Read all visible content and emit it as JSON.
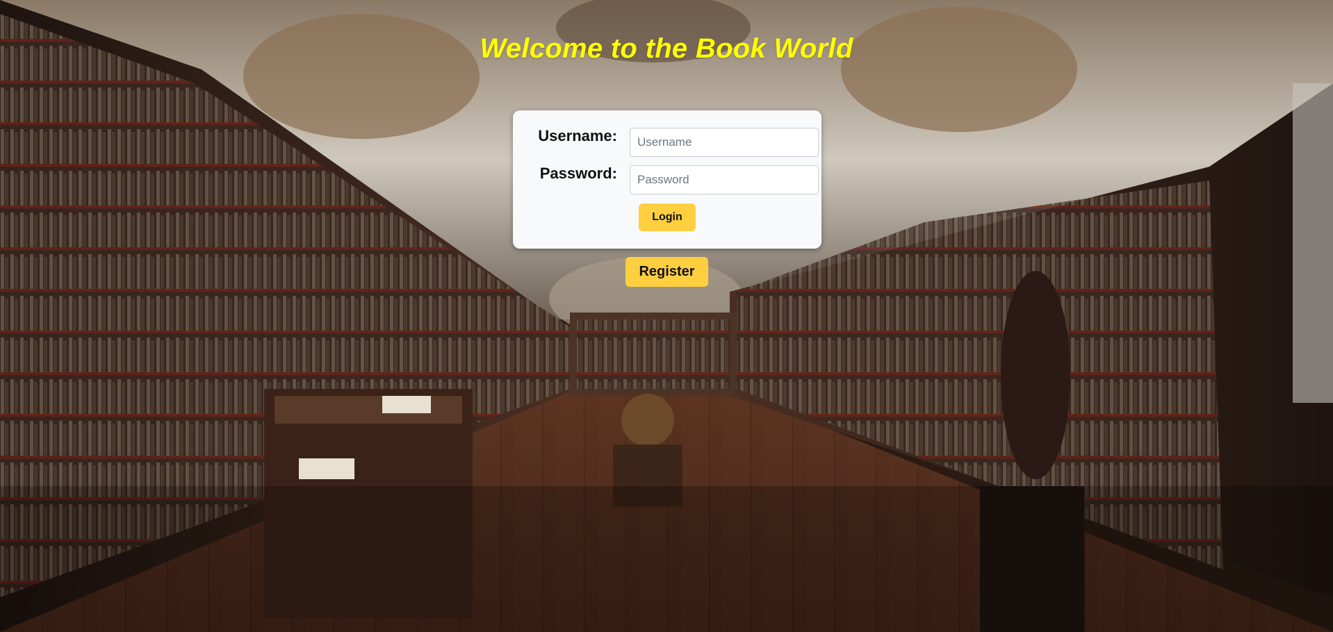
{
  "page": {
    "title": "Welcome to the Book World",
    "title_color": "#ffff00"
  },
  "login_form": {
    "username_label": "Username:",
    "username_placeholder": "Username",
    "username_value": "",
    "password_label": "Password:",
    "password_placeholder": "Password",
    "password_value": "",
    "login_button": "Login"
  },
  "register_button": "Register",
  "colors": {
    "button_background": "#ffcf40",
    "card_background": "#f8f9fa"
  },
  "background": {
    "description_icon": "library-background-image"
  }
}
